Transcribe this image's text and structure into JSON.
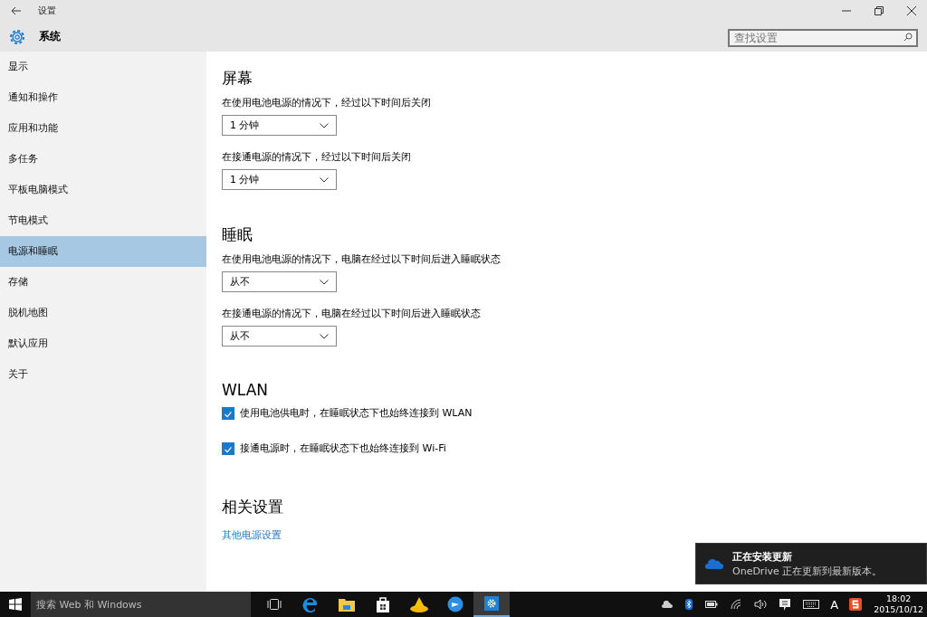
{
  "window": {
    "title": "设置"
  },
  "header": {
    "title": "系统"
  },
  "search": {
    "placeholder": "查找设置"
  },
  "sidebar": {
    "items": [
      {
        "label": "显示",
        "selected": false
      },
      {
        "label": "通知和操作",
        "selected": false
      },
      {
        "label": "应用和功能",
        "selected": false
      },
      {
        "label": "多任务",
        "selected": false
      },
      {
        "label": "平板电脑模式",
        "selected": false
      },
      {
        "label": "节电模式",
        "selected": false
      },
      {
        "label": "电源和睡眠",
        "selected": true
      },
      {
        "label": "存储",
        "selected": false
      },
      {
        "label": "脱机地图",
        "selected": false
      },
      {
        "label": "默认应用",
        "selected": false
      },
      {
        "label": "关于",
        "selected": false
      }
    ]
  },
  "sections": [
    {
      "title": "屏幕",
      "settings": [
        {
          "kind": "dropdown",
          "label": "在使用电池电源的情况下，经过以下时间后关闭",
          "value": "1 分钟"
        },
        {
          "kind": "dropdown",
          "label": "在接通电源的情况下，经过以下时间后关闭",
          "value": "1 分钟"
        }
      ]
    },
    {
      "title": "睡眠",
      "settings": [
        {
          "kind": "dropdown",
          "label": "在使用电池电源的情况下，电脑在经过以下时间后进入睡眠状态",
          "value": "从不"
        },
        {
          "kind": "dropdown",
          "label": "在接通电源的情况下，电脑在经过以下时间后进入睡眠状态",
          "value": "从不"
        }
      ]
    },
    {
      "title": "WLAN",
      "settings": [
        {
          "kind": "checkbox",
          "label": "使用电池供电时，在睡眠状态下也始终连接到 WLAN",
          "checked": true
        },
        {
          "kind": "checkbox",
          "label": "接通电源时，在睡眠状态下也始终连接到 Wi-Fi",
          "checked": true
        }
      ]
    },
    {
      "title": "相关设置",
      "settings": [
        {
          "kind": "link",
          "label": "其他电源设置"
        }
      ]
    }
  ],
  "toast": {
    "title": "正在安装更新",
    "message": "OneDrive 正在更新到最新版本。"
  },
  "taskbar": {
    "search_placeholder": "搜索 Web 和 Windows",
    "time": "18:02",
    "date": "2015/10/12",
    "ime": "A"
  }
}
